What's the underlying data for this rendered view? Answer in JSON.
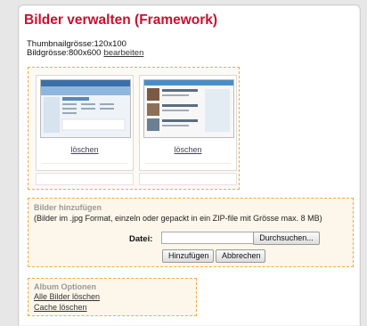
{
  "page": {
    "title": "Bilder verwalten (Framework)",
    "thumbnail_size": "Thumbnailgrösse:120x100",
    "image_size": "Bildgrösse:800x600",
    "edit_link": "bearbeiten"
  },
  "gallery": {
    "items": [
      {
        "delete_label": "löschen"
      },
      {
        "delete_label": "löschen"
      }
    ]
  },
  "add_images": {
    "legend": "Bilder hinzufügen",
    "hint": "(Bilder im .jpg Format, einzeln oder gepackt in ein ZIP-file mit Grösse max. 8 MB)",
    "file_label": "Datei:",
    "file_value": "",
    "browse_label": "Durchsuchen...",
    "submit_label": "Hinzufügen",
    "cancel_label": "Abbrechen"
  },
  "album_options": {
    "legend": "Album Optionen",
    "delete_all_label": "Alle Bilder löschen",
    "clear_cache_label": "Cache löschen"
  },
  "colors": {
    "title": "#c8102e",
    "box_border": "#f0a94a",
    "box_fill": "#fdf6ea"
  }
}
